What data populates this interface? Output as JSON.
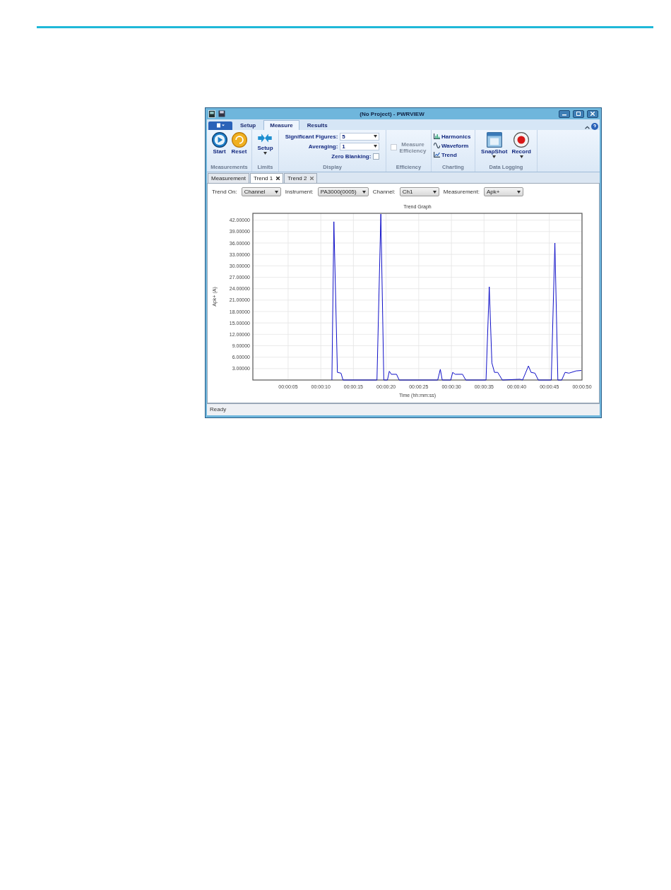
{
  "window": {
    "title": "(No Project) - PWRVIEW"
  },
  "ribbon_tabs": [
    {
      "label": "Setup",
      "selected": false
    },
    {
      "label": "Measure",
      "selected": true
    },
    {
      "label": "Results",
      "selected": false
    }
  ],
  "groups": {
    "measurements": {
      "label": "Measurements",
      "start": "Start",
      "reset": "Reset"
    },
    "limits": {
      "label": "Limits",
      "setup": "Setup"
    },
    "display": {
      "label": "Display",
      "significant_figures": {
        "label": "Significant Figures:",
        "value": "5"
      },
      "averaging": {
        "label": "Averaging:",
        "value": "1"
      },
      "zero_blanking": {
        "label": "Zero Blanking:",
        "checked": false
      }
    },
    "efficiency": {
      "label": "Efficiency",
      "measure_efficiency": {
        "label": "Measure Efficiency",
        "checked": false,
        "disabled": true
      }
    },
    "charting": {
      "label": "Charting",
      "harmonics": "Harmonics",
      "waveform": "Waveform",
      "trend": "Trend"
    },
    "data_logging": {
      "label": "Data Logging",
      "snapshot": "SnapShot",
      "record": "Record"
    }
  },
  "doc_tabs": [
    {
      "label": "Measurement",
      "selected": false,
      "closable": false
    },
    {
      "label": "Trend 1",
      "selected": true,
      "closable": true
    },
    {
      "label": "Trend 2",
      "selected": false,
      "closable": true
    }
  ],
  "filters": [
    {
      "label": "Trend On:",
      "value": "Channel"
    },
    {
      "label": "Instrument:",
      "value": "PA3000(0005)"
    },
    {
      "label": "Channel:",
      "value": "Ch1"
    },
    {
      "label": "Measurement:",
      "value": "Apk+"
    }
  ],
  "chart": {
    "chart_data": {
      "type": "line",
      "title": "Trend Graph",
      "xlabel": "Time (hh:mm:ss)",
      "ylabel": "Apk+ (A)",
      "grid": true,
      "x": [
        11.7,
        12.0,
        12.55,
        13.1,
        13.4,
        18.6,
        19.2,
        19.65,
        20.2,
        20.5,
        20.8,
        21.6,
        22.0,
        27.9,
        28.3,
        28.6,
        29.9,
        30.2,
        30.6,
        31.7,
        32.2,
        35.3,
        35.8,
        36.2,
        36.6,
        37.1,
        37.8,
        40.5,
        40.9,
        41.8,
        42.2,
        42.8,
        43.3,
        45.3,
        45.85,
        46.3,
        46.9,
        47.4,
        48.0,
        49.1,
        49.9
      ],
      "series": [
        {
          "color": "#1010c8",
          "values": [
            0,
            41.6,
            2,
            1.8,
            0,
            0,
            43.6,
            0,
            0,
            2.3,
            1.5,
            1.5,
            0,
            0,
            2.8,
            0,
            0,
            2,
            1.5,
            1.5,
            0,
            0,
            24.5,
            4.5,
            2,
            2,
            0,
            0.2,
            0,
            3.7,
            2,
            1.8,
            0,
            0,
            36,
            0,
            0,
            2,
            1.8,
            2.4,
            2.5
          ]
        }
      ],
      "xlim": [
        -0.4,
        50
      ],
      "ylim": [
        0,
        43.8
      ],
      "xticks": [
        {
          "value": 5,
          "label": "00:00:05"
        },
        {
          "value": 10,
          "label": "00:00:10"
        },
        {
          "value": 15,
          "label": "00:00:15"
        },
        {
          "value": 20,
          "label": "00:00:20"
        },
        {
          "value": 25,
          "label": "00:00:25"
        },
        {
          "value": 30,
          "label": "00:00:30"
        },
        {
          "value": 35,
          "label": "00:00:35"
        },
        {
          "value": 40,
          "label": "00:00:40"
        },
        {
          "value": 45,
          "label": "00:00:45"
        },
        {
          "value": 50,
          "label": "00:00:50"
        }
      ],
      "yticks": [
        {
          "value": 3,
          "label": "3.00000"
        },
        {
          "value": 6,
          "label": "6.00000"
        },
        {
          "value": 9,
          "label": "9.00000"
        },
        {
          "value": 12,
          "label": "12.00000"
        },
        {
          "value": 15,
          "label": "15.00000"
        },
        {
          "value": 18,
          "label": "18.00000"
        },
        {
          "value": 21,
          "label": "21.00000"
        },
        {
          "value": 24,
          "label": "24.00000"
        },
        {
          "value": 27,
          "label": "27.00000"
        },
        {
          "value": 30,
          "label": "30.00000"
        },
        {
          "value": 33,
          "label": "33.00000"
        },
        {
          "value": 36,
          "label": "36.00000"
        },
        {
          "value": 39,
          "label": "39.00000"
        },
        {
          "value": 42,
          "label": "42.00000"
        }
      ]
    }
  },
  "status_bar": {
    "text": "Ready"
  }
}
